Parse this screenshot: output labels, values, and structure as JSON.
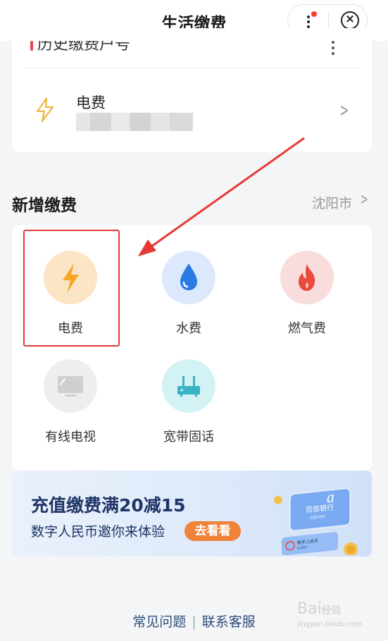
{
  "header": {
    "title": "生活缴费"
  },
  "history": {
    "label": "历史缴费户号",
    "item": {
      "name": "电费"
    }
  },
  "new_payment": {
    "title": "新增缴费",
    "city": "沈阳市",
    "services": [
      {
        "label": "电费",
        "icon": "lightning-icon",
        "color": "#f5a623"
      },
      {
        "label": "水费",
        "icon": "water-drop-icon",
        "color": "#2a7be4"
      },
      {
        "label": "燃气费",
        "icon": "flame-icon",
        "color": "#e84a3c"
      },
      {
        "label": "有线电视",
        "icon": "tv-icon",
        "color": "#cfcfcf"
      },
      {
        "label": "宽带固话",
        "icon": "router-icon",
        "color": "#3ab3c4"
      }
    ]
  },
  "banner": {
    "title": "充值缴费满20减15",
    "subtitle": "数字人民币邀你来体验",
    "button": "去看看",
    "card_brand": "百信银行",
    "card_brand_en": "AIBANK",
    "card2_text": "数字人民币",
    "card2_sub": "e-CNY"
  },
  "footer": {
    "faq": "常见问题",
    "separator": "|",
    "contact": "联系客服"
  },
  "watermark": {
    "main": "Bai",
    "cn": "经验",
    "url": "jingyan.baidu.com"
  },
  "colors": {
    "accent_red": "#e53935",
    "electric": "#f5a623",
    "water": "#2a7be4",
    "gas": "#e84a3c"
  }
}
